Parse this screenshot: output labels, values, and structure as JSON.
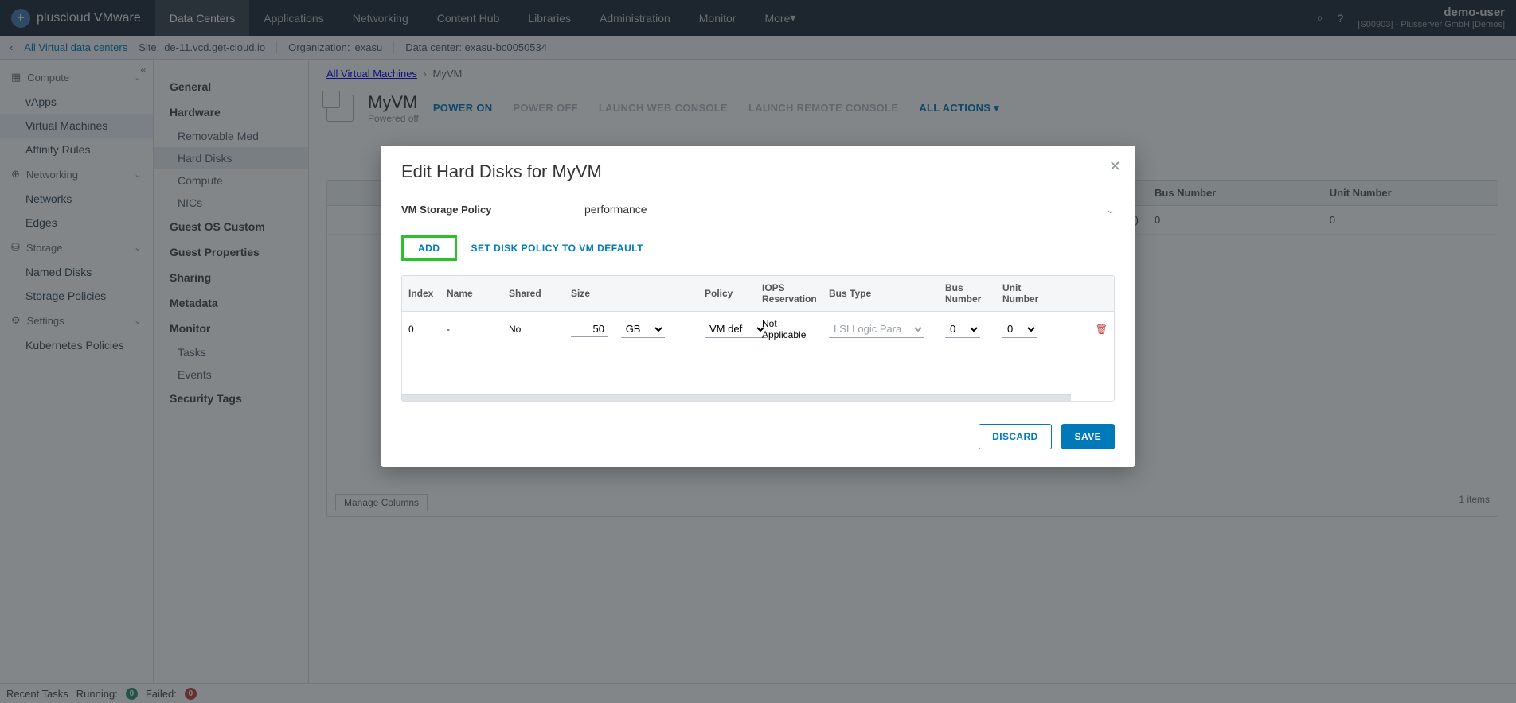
{
  "brand": "pluscloud VMware",
  "topnav": {
    "items": [
      "Data Centers",
      "Applications",
      "Networking",
      "Content Hub",
      "Libraries",
      "Administration",
      "Monitor",
      "More"
    ],
    "activeIndex": 0
  },
  "user": {
    "name": "demo-user",
    "sub": "[S00903] - Plusserver GmbH [Demos]"
  },
  "subbar": {
    "back": "All Virtual data centers",
    "site_label": "Site:",
    "site_value": "de-11.vcd.get-cloud.io",
    "org_label": "Organization:",
    "org_value": "exasu",
    "dc_label": "Data center:",
    "dc_value": "exasu-bc0050534"
  },
  "leftnav": {
    "sections": [
      {
        "title": "Compute",
        "items": [
          "vApps",
          "Virtual Machines",
          "Affinity Rules"
        ],
        "activeItem": 1
      },
      {
        "title": "Networking",
        "items": [
          "Networks",
          "Edges"
        ]
      },
      {
        "title": "Storage",
        "items": [
          "Named Disks",
          "Storage Policies"
        ]
      },
      {
        "title": "Settings",
        "items": [
          "Kubernetes Policies"
        ]
      }
    ]
  },
  "breadcrumb": {
    "root": "All Virtual Machines",
    "current": "MyVM"
  },
  "vm": {
    "name": "MyVM",
    "state": "Powered off",
    "actions": [
      "POWER ON",
      "POWER OFF",
      "LAUNCH WEB CONSOLE",
      "LAUNCH REMOTE CONSOLE"
    ],
    "enabled": [
      true,
      false,
      false,
      false
    ],
    "all_actions": "ALL ACTIONS"
  },
  "midpanel": {
    "groups": [
      {
        "head": "General",
        "items": []
      },
      {
        "head": "Hardware",
        "items": [
          "Removable Med",
          "Hard Disks",
          "Compute",
          "NICs"
        ],
        "activeItem": 1
      },
      {
        "head": "Guest OS Custom",
        "items": []
      },
      {
        "head": "Guest Properties",
        "items": []
      },
      {
        "head": "Sharing",
        "items": []
      },
      {
        "head": "Metadata",
        "items": []
      },
      {
        "head": "Monitor",
        "items": [
          "Tasks",
          "Events"
        ]
      },
      {
        "head": "Security Tags",
        "items": []
      }
    ]
  },
  "bgtable": {
    "cols": [
      "Bus Number",
      "Unit Number"
    ],
    "row": {
      "bus_type_frag": "llel (SCSI)",
      "bus_number": "0",
      "unit_number": "0"
    },
    "items": "1 items",
    "manage": "Manage Columns"
  },
  "statusbar": {
    "recent": "Recent Tasks",
    "running_label": "Running:",
    "running_value": "0",
    "failed_label": "Failed:",
    "failed_value": "0"
  },
  "modal": {
    "title": "Edit Hard Disks for MyVM",
    "policy_label": "VM Storage Policy",
    "policy_value": "performance",
    "add": "ADD",
    "set_default": "SET DISK POLICY TO VM DEFAULT",
    "cols": [
      "Index",
      "Name",
      "Shared",
      "Size",
      "Policy",
      "IOPS Reservation",
      "Bus Type",
      "Bus Number",
      "Unit Number"
    ],
    "row": {
      "index": "0",
      "name": "-",
      "shared": "No",
      "size_value": "50",
      "size_unit": "GB",
      "policy": "VM def",
      "iops": "Not Applicable",
      "bus_type": "LSI Logic Parallel (SCS",
      "bus_number": "0",
      "unit_number": "0"
    },
    "discard": "DISCARD",
    "save": "SAVE"
  }
}
